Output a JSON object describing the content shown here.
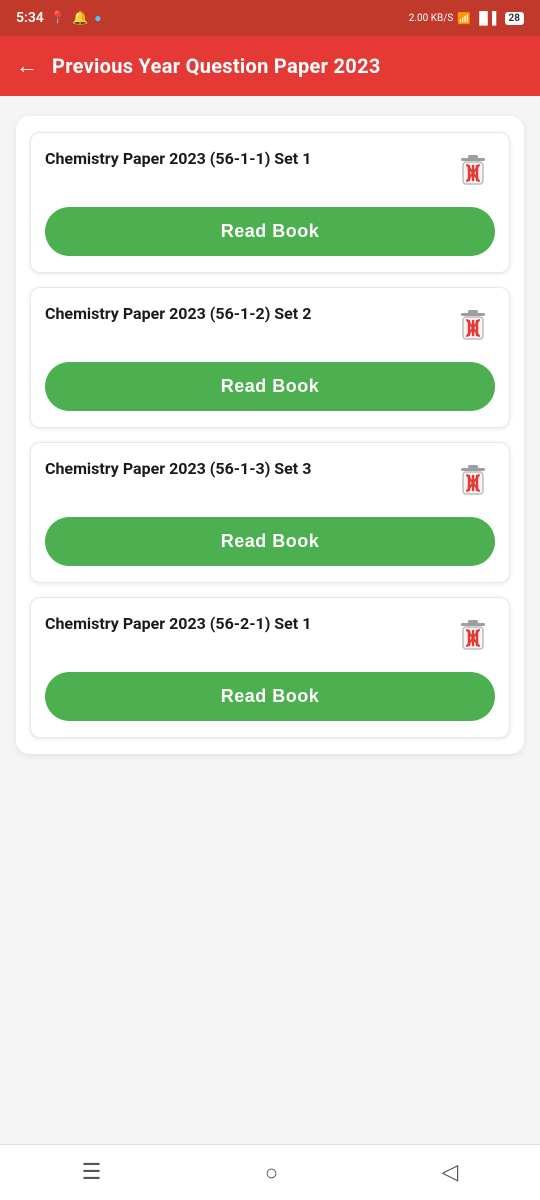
{
  "statusBar": {
    "time": "5:34",
    "battery": "28",
    "networkSpeed": "2.00 KB/S"
  },
  "appBar": {
    "title": "Previous Year Question Paper 2023",
    "backIcon": "←"
  },
  "books": [
    {
      "id": 1,
      "title": "Chemistry Paper 2023 (56-1-1) Set 1",
      "readLabel": "Read Book"
    },
    {
      "id": 2,
      "title": "Chemistry Paper 2023 (56-1-2) Set 2",
      "readLabel": "Read Book"
    },
    {
      "id": 3,
      "title": "Chemistry Paper 2023 (56-1-3) Set 3",
      "readLabel": "Read Book"
    },
    {
      "id": 4,
      "title": "Chemistry Paper 2023 (56-2-1) Set 1",
      "readLabel": "Read Book"
    }
  ],
  "bottomNav": {
    "menuIcon": "☰",
    "homeIcon": "○",
    "backIcon": "◁"
  }
}
